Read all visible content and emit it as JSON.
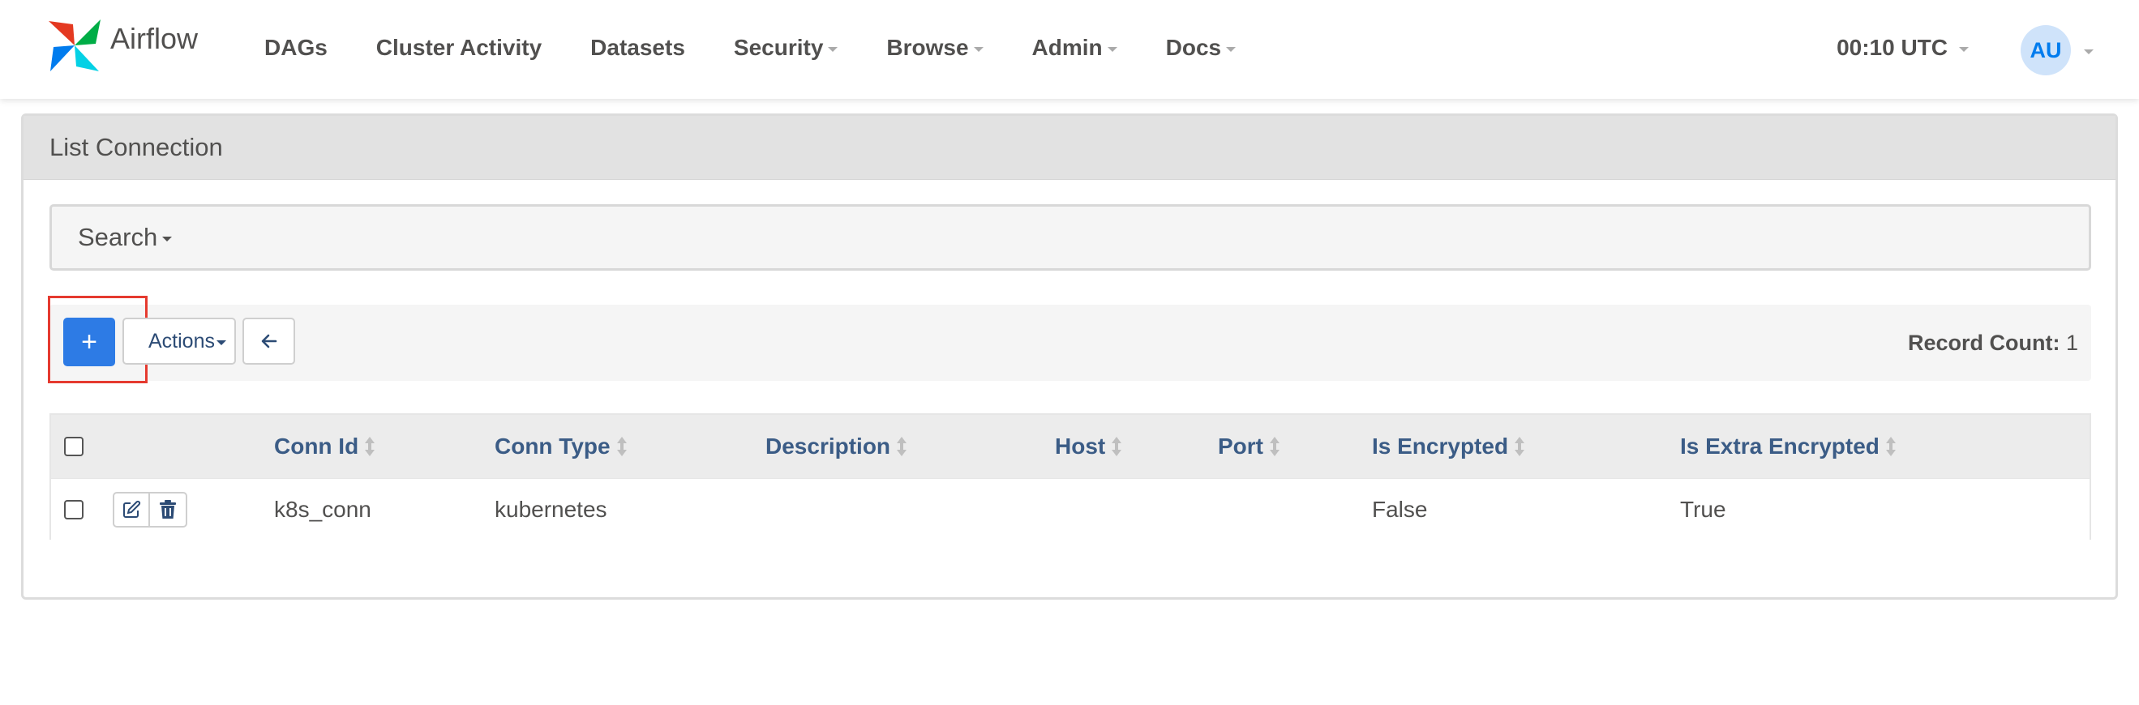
{
  "brand": {
    "name": "Airflow"
  },
  "nav": {
    "items": [
      {
        "label": "DAGs",
        "dropdown": false
      },
      {
        "label": "Cluster Activity",
        "dropdown": false
      },
      {
        "label": "Datasets",
        "dropdown": false
      },
      {
        "label": "Security",
        "dropdown": true
      },
      {
        "label": "Browse",
        "dropdown": true
      },
      {
        "label": "Admin",
        "dropdown": true
      },
      {
        "label": "Docs",
        "dropdown": true
      }
    ],
    "clock": "00:10 UTC",
    "user_initials": "AU"
  },
  "panel": {
    "title": "List Connection",
    "search_label": "Search",
    "add_label": "+",
    "actions_label": "Actions",
    "record_count_label": "Record Count:",
    "record_count_value": "1"
  },
  "table": {
    "columns": [
      "Conn Id",
      "Conn Type",
      "Description",
      "Host",
      "Port",
      "Is Encrypted",
      "Is Extra Encrypted"
    ],
    "rows": [
      {
        "conn_id": "k8s_conn",
        "conn_type": "kubernetes",
        "description": "",
        "host": "",
        "port": "",
        "is_encrypted": "False",
        "is_extra_encrypted": "True"
      }
    ]
  },
  "colors": {
    "accent": "#2d7be5",
    "highlight": "#e53a2f",
    "link": "#3b5c86"
  },
  "icons": {
    "brand": "airflow-pinwheel-icon",
    "edit": "edit-icon",
    "delete": "trash-icon",
    "back": "arrow-left-icon"
  }
}
